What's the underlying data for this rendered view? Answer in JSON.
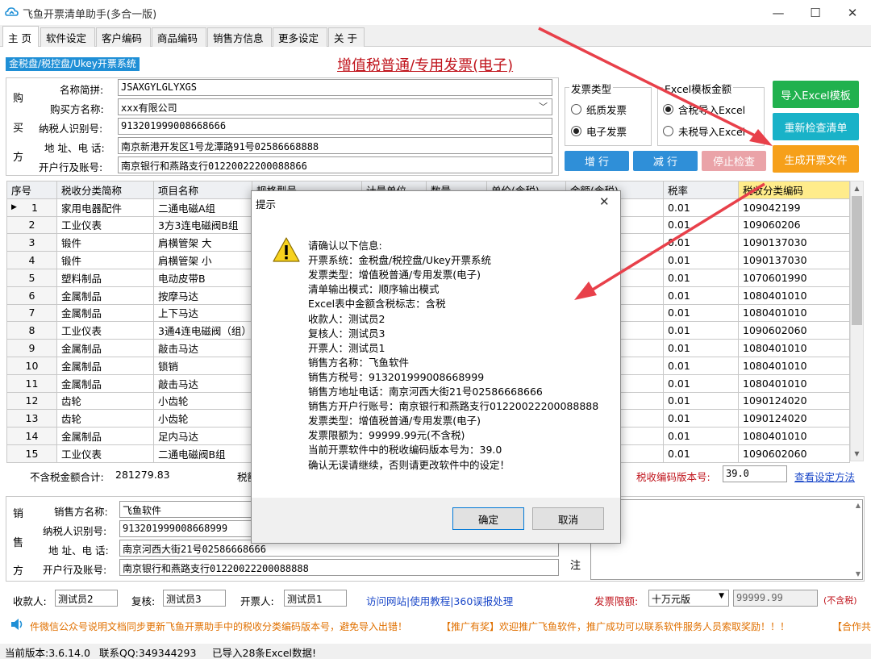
{
  "window": {
    "title": "飞鱼开票清单助手(多合一版)",
    "minimize": "—",
    "maximize": "☐",
    "close": "✕"
  },
  "tabs": [
    {
      "label": "主 页"
    },
    {
      "label": "软件设定"
    },
    {
      "label": "客户编码"
    },
    {
      "label": "商品编码"
    },
    {
      "label": "销售方信息"
    },
    {
      "label": "更多设定"
    },
    {
      "label": "关 于"
    }
  ],
  "header": {
    "system": "金税盘/税控盘/Ukey开票系统",
    "title": "增值税普通/专用发票(电子)"
  },
  "buyer": {
    "section_chars": [
      "购",
      "买",
      "方"
    ],
    "short_name_label": "名称简拼:",
    "short_name": "JSAXGYLGLYXGS",
    "name_label": "购买方名称:",
    "name": "xxx有限公司",
    "tax_id_label": "纳税人识别号:",
    "tax_id": "913201999008668666",
    "address_label": "地 址、电 话:",
    "address": "南京新港开发区1号龙潭路91号02586668888",
    "bank_label": "开户行及账号:",
    "bank": "南京银行和燕路支行01220022200088866"
  },
  "invoice_type": {
    "title": "发票类型",
    "paper": "纸质发票",
    "electronic": "电子发票",
    "selected": "electronic"
  },
  "excel_amount": {
    "title": "Excel模板金额",
    "tax_included": "含税导入Excel",
    "tax_excluded": "未税导入Excel",
    "selected": "tax_included"
  },
  "buttons": {
    "import_excel": "导入Excel模板",
    "recheck": "重新检查清单",
    "generate": "生成开票文件",
    "add_row": "增 行",
    "remove_row": "减 行",
    "stop_check": "停止检查"
  },
  "colors": {
    "green": "#21b14e",
    "teal": "#19b2c8",
    "orange": "#f6a01a",
    "blue": "#2f8fd8",
    "stop_pink": "#eaa3a8",
    "arrow_red": "#e8404a",
    "title_red": "#c0141c",
    "link_blue": "#1a47c8"
  },
  "table": {
    "columns": [
      "序号",
      "税收分类简称",
      "项目名称",
      "规格型号",
      "计量单位",
      "数量",
      "单价(含税)",
      "金额(含税)",
      "税率",
      "税收分类编码"
    ],
    "rows": [
      {
        "no": "1",
        "cat": "家用电器配件",
        "item": "二通电磁A组",
        "amt": "18",
        "rate": "0.01",
        "code": "109042199"
      },
      {
        "no": "2",
        "cat": "工业仪表",
        "item": "3方3连电磁阀B组",
        "amt": "65",
        "rate": "0.01",
        "code": "109060206"
      },
      {
        "no": "3",
        "cat": "锻件",
        "item": "肩横管架 大",
        "amt": "35",
        "rate": "0.01",
        "code": "1090137030"
      },
      {
        "no": "4",
        "cat": "锻件",
        "item": "肩横管架 小",
        "amt": "56",
        "rate": "0.01",
        "code": "1090137030"
      },
      {
        "no": "5",
        "cat": "塑料制品",
        "item": "电动皮带B",
        "amt": "08",
        "rate": "0.01",
        "code": "1070601990"
      },
      {
        "no": "6",
        "cat": "金属制品",
        "item": "按摩马达",
        "amt": "5.37",
        "rate": "0.01",
        "code": "1080401010"
      },
      {
        "no": "7",
        "cat": "金属制品",
        "item": "上下马达",
        "amt": "5.37",
        "rate": "0.01",
        "code": "1080401010"
      },
      {
        "no": "8",
        "cat": "工业仪表",
        "item": "3通4连电磁阀（组）",
        "amt": "01",
        "rate": "0.01",
        "code": "1090602060"
      },
      {
        "no": "9",
        "cat": "金属制品",
        "item": "敲击马达",
        "amt": "35",
        "rate": "0.01",
        "code": "1080401010"
      },
      {
        "no": "10",
        "cat": "金属制品",
        "item": "锁销",
        "amt": "5",
        "rate": "0.01",
        "code": "1080401010"
      },
      {
        "no": "11",
        "cat": "金属制品",
        "item": "敲击马达",
        "amt": "5",
        "rate": "0.01",
        "code": "1080401010"
      },
      {
        "no": "12",
        "cat": "齿轮",
        "item": "小齿轮",
        "amt": "28",
        "rate": "0.01",
        "code": "1090124020"
      },
      {
        "no": "13",
        "cat": "齿轮",
        "item": "小齿轮",
        "amt": "75",
        "rate": "0.01",
        "code": "1090124020"
      },
      {
        "no": "14",
        "cat": "金属制品",
        "item": "足内马达",
        "amt": "37",
        "rate": "0.01",
        "code": "1080401010"
      },
      {
        "no": "15",
        "cat": "工业仪表",
        "item": "二通电磁阀B组",
        "amt": "4",
        "rate": "0.01",
        "code": "1090602060"
      }
    ]
  },
  "totals": {
    "pre_tax_label": "不含税金额合计:",
    "pre_tax": "281279.83",
    "tax_label_partial": "税额",
    "version_label": "税收编码版本号:",
    "version": "39.0",
    "setup_link": "查看设定方法"
  },
  "seller": {
    "section_chars": [
      "销",
      "售",
      "方"
    ],
    "name_label": "销售方名称:",
    "name": "飞鱼软件",
    "tax_id_label": "纳税人识别号:",
    "tax_id": "913201999008668999",
    "address_label": "地 址、电 话:",
    "address": "南京河西大街21号02586668666",
    "bank_label": "开户行及账号:",
    "bank": "南京银行和燕路支行01220022200088888",
    "remark_char": "注"
  },
  "staff": {
    "payee_label": "收款人:",
    "payee": "测试员2",
    "reviewer_label": "复核:",
    "reviewer": "测试员3",
    "issuer_label": "开票人:",
    "issuer": "测试员1",
    "links": "访问网站|使用教程|360误报处理",
    "limit_label": "发票限额:",
    "limit_select": "十万元版",
    "limit_value": "99999.99",
    "limit_note": "(不含税)"
  },
  "marquee": {
    "text1": "件微信公众号说明文档同步更新飞鱼开票助手中的税收分类编码版本号，避免导入出错！",
    "text2": "【推广有奖】欢迎推广飞鱼软件，推广成功可以联系软件服务人员索取奖励！！！",
    "text3": "【合作共"
  },
  "status": {
    "version": "当前版本:3.6.14.0",
    "qq": "联系QQ:349344293",
    "imported": "已导入28条Excel数据!"
  },
  "dialog": {
    "title": "提示",
    "lines": [
      "请确认以下信息:",
      "开票系统：金税盘/税控盘/Ukey开票系统",
      "发票类型：增值税普通/专用发票(电子)",
      "清单输出模式：顺序输出模式",
      "Excel表中金额含税标志：含税",
      "收款人：测试员2",
      "复核人：测试员3",
      "开票人：测试员1",
      "销售方名称：飞鱼软件",
      "销售方税号：913201999008668999",
      "销售方地址电话：南京河西大街21号02586668666",
      "销售方开户行账号：南京银行和燕路支行01220022200088888",
      "发票类型：增值税普通/专用发票(电子)",
      "发票限额为：99999.99元(不含税)",
      "当前开票软件中的税收编码版本号为：39.0",
      "确认无误请继续，否则请更改软件中的设定！"
    ],
    "ok": "确定",
    "cancel": "取消"
  }
}
